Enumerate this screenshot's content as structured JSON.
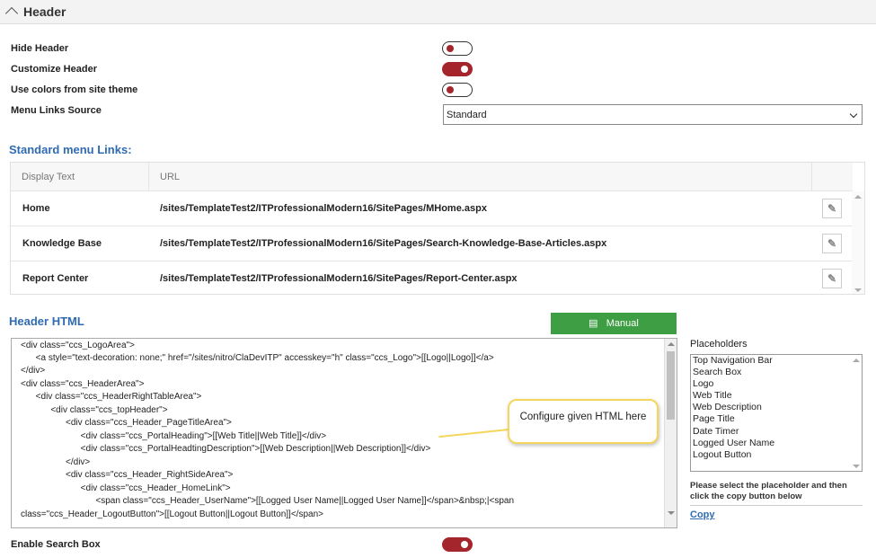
{
  "header": {
    "title": "Header"
  },
  "settings": [
    {
      "label": "Hide Header",
      "on": false
    },
    {
      "label": "Customize Header",
      "on": true
    },
    {
      "label": "Use colors from site theme",
      "on": false
    }
  ],
  "menu_source": {
    "label": "Menu Links Source",
    "value": "Standard"
  },
  "standard_links": {
    "title": "Standard menu Links:",
    "columns": [
      "Display Text",
      "URL"
    ],
    "rows": [
      {
        "text": "Home",
        "url": "/sites/TemplateTest2/ITProfessionalModern16/SitePages/MHome.aspx"
      },
      {
        "text": "Knowledge Base",
        "url": "/sites/TemplateTest2/ITProfessionalModern16/SitePages/Search-Knowledge-Base-Articles.aspx"
      },
      {
        "text": "Report Center",
        "url": "/sites/TemplateTest2/ITProfessionalModern16/SitePages/Report-Center.aspx"
      }
    ]
  },
  "header_html": {
    "title": "Header HTML",
    "manual_label": "Manual",
    "lines": [
      "<div class=\"ccs_LogoArea\">",
      "      <a style=\"text-decoration: none;\" href=\"/sites/nitro/ClaDevITP\" accesskey=\"h\" class=\"ccs_Logo\">[[Logo||Logo]]</a>",
      "</div>",
      "<div class=\"ccs_HeaderArea\">",
      "      <div class=\"ccs_HeaderRightTableArea\">",
      "            <div class=\"ccs_topHeader\">",
      "                  <div class=\"ccs_Header_PageTitleArea\">",
      "                        <div class=\"ccs_PortalHeading\">[[Web Title||Web Title]]</div>",
      "                        <div class=\"ccs_PortalHeadtingDescription\">[[Web Description||Web Description]]</div>",
      "                  </div>",
      "                  <div class=\"ccs_Header_RightSideArea\">",
      "                        <div class=\"ccs_Header_HomeLink\">",
      "                              <span class=\"ccs_Header_UserName\">[[Logged User Name||Logged User Name]]</span>&nbsp;|<span",
      "class=\"ccs_Header_LogoutButton\">[[Logout Button||Logout Button]]</span>"
    ]
  },
  "callout": "Configure given HTML here",
  "placeholders": {
    "label": "Placeholders",
    "items": [
      "Top Navigation Bar",
      "Search Box",
      "Logo",
      "Web Title",
      "Web Description",
      "Page Title",
      "Date Timer",
      "Logged User Name",
      "Logout Button"
    ],
    "note": "Please select the placeholder and then click the copy button below",
    "copy_label": "Copy"
  },
  "enable_search": {
    "label": "Enable Search Box",
    "on": true
  },
  "colors": {
    "toggle_on": "#a4262c",
    "accent": "#2f6bb3",
    "manual_button": "#3e9e44",
    "callout_border": "#f4d65c"
  }
}
